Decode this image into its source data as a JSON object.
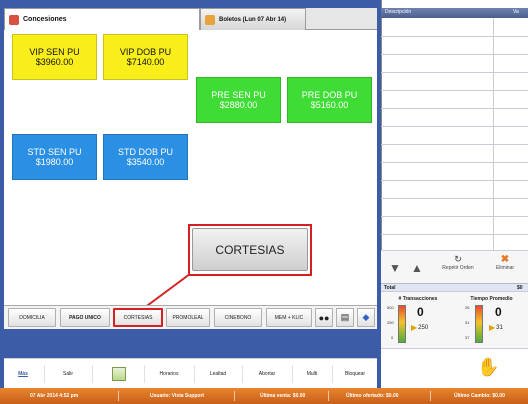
{
  "tabs": [
    {
      "label": "Concesiones",
      "icon": "concessions-icon",
      "active": true
    },
    {
      "label": "Boletos (Lun 07 Abr 14)",
      "icon": "tickets-icon",
      "active": false
    }
  ],
  "tiles": [
    {
      "name": "VIP SEN PU",
      "price": "$3960.00",
      "color": "#f8ee1a"
    },
    {
      "name": "VIP DOB PU",
      "price": "$7140.00",
      "color": "#f8ee1a"
    },
    {
      "name": "PRE SEN PU",
      "price": "$2880.00",
      "color": "#3fdc35"
    },
    {
      "name": "PRE DOB PU",
      "price": "$5160.00",
      "color": "#3fdc35"
    },
    {
      "name": "STD SEN PU",
      "price": "$1980.00",
      "color": "#2b8fe3"
    },
    {
      "name": "STD DOB PU",
      "price": "$3540.00",
      "color": "#2b8fe3"
    }
  ],
  "callout": {
    "label": "CORTESIAS"
  },
  "categories": [
    "DOMICILIA",
    "PAGO UNICO",
    "CORTESIAS",
    "PROMOLEAL",
    "CINEBONO",
    "MEM + KLIC"
  ],
  "category_icons": [
    "glasses-icon",
    "film-icon",
    "globe-icon"
  ],
  "functions": [
    "Más",
    "Salir",
    "",
    "Horarios",
    "Lealtad",
    "Abortar",
    "Multi",
    "Bloquear"
  ],
  "order": {
    "col_description": "Descripción",
    "col_amount": "Va",
    "repeat_label": "Repetir Orden",
    "delete_label": "Eliminar",
    "total_label": "Total",
    "total_value": "$0"
  },
  "gauges": {
    "transactions": {
      "title": "# Transacciones",
      "value": "0",
      "sub": "250",
      "scale": [
        "500",
        "250",
        "0"
      ]
    },
    "time": {
      "title": "Tiempo Promedio",
      "value": "0",
      "sub": "31",
      "scale": [
        "26",
        "31",
        "37"
      ]
    }
  },
  "status": {
    "datetime": "07 Abr 2014 4:52 pm",
    "user": "Usuario: Vista Support",
    "last_sale": "Última venta: $0.00",
    "last_tendered": "Último ofertado: $0.00",
    "last_change": "Último Cambio: $0.00"
  },
  "colors": {
    "frame": "#3d5ca8",
    "accent_red": "#d42020",
    "status_orange": "#e07a28",
    "header_blue": "#5a6d9c"
  }
}
